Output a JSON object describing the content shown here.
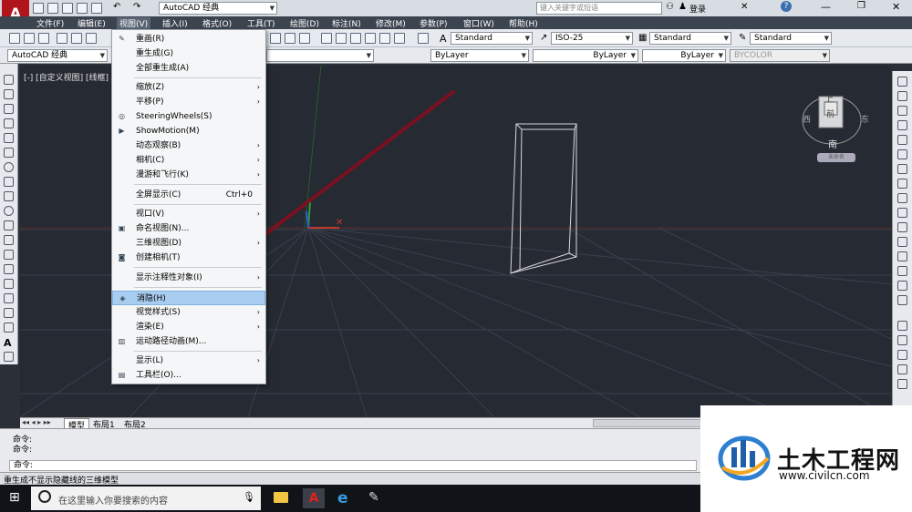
{
  "titlebar": {
    "workspace": "AutoCAD 经典",
    "search_placeholder": "键入关键字或短语",
    "login": "登录"
  },
  "menubar": [
    "文件(F)",
    "编辑(E)",
    "视图(V)",
    "插入(I)",
    "格式(O)",
    "工具(T)",
    "绘图(D)",
    "标注(N)",
    "修改(M)",
    "参数(P)",
    "窗口(W)",
    "帮助(H)"
  ],
  "toolbar": {
    "textstyle": "Standard",
    "dimstyle": "ISO-25",
    "tablestyle": "Standard",
    "mleaderstyle": "Standard",
    "workspace2": "AutoCAD 经典",
    "color": "ByLayer",
    "linetype": "ByLayer",
    "lineweight": "ByLayer",
    "plotstyle": "BYCOLOR"
  },
  "viewport": {
    "label": "[-] [自定义视图] [线框]"
  },
  "viewcube": {
    "top": "上",
    "front": "南",
    "west": "西",
    "east": "东",
    "face": "前",
    "wcs": "未命名"
  },
  "menu": {
    "items": [
      {
        "label": "重画(R)",
        "icon": "redraw-icon"
      },
      {
        "label": "重生成(G)"
      },
      {
        "label": "全部重生成(A)"
      },
      {
        "label": "缩放(Z)",
        "submenu": true
      },
      {
        "label": "平移(P)",
        "submenu": true
      },
      {
        "label": "SteeringWheels(S)",
        "icon": "steeringwheel-icon"
      },
      {
        "label": "ShowMotion(M)",
        "icon": "showmotion-icon"
      },
      {
        "label": "动态观察(B)",
        "submenu": true
      },
      {
        "label": "相机(C)",
        "submenu": true
      },
      {
        "label": "漫游和飞行(K)",
        "submenu": true
      },
      {
        "label": "全屏显示(C)",
        "shortcut": "Ctrl+0"
      },
      {
        "label": "视口(V)",
        "submenu": true
      },
      {
        "label": "命名视图(N)...",
        "icon": "namedview-icon"
      },
      {
        "label": "三维视图(D)",
        "submenu": true
      },
      {
        "label": "创建相机(T)",
        "icon": "camera-icon"
      },
      {
        "label": "显示注释性对象(I)",
        "submenu": true
      },
      {
        "label": "消隐(H)",
        "icon": "hide-icon",
        "highlighted": true
      },
      {
        "label": "视觉样式(S)",
        "submenu": true
      },
      {
        "label": "渲染(E)",
        "submenu": true
      },
      {
        "label": "运动路径动画(M)...",
        "icon": "motionpath-icon"
      },
      {
        "label": "显示(L)",
        "submenu": true
      },
      {
        "label": "工具栏(O)...",
        "icon": "toolbar-icon"
      }
    ]
  },
  "layout_tabs": [
    "模型",
    "布局1",
    "布局2"
  ],
  "command": {
    "line1": "命令:",
    "line2": "命令:",
    "prompt": "命令:"
  },
  "status_text": "重生成不显示隐藏线的三维模型",
  "taskbar": {
    "search_placeholder": "在这里输入你要搜索的内容"
  },
  "watermark": {
    "cn": "土木工程网",
    "url": "www.civilcn.com"
  },
  "colors": {
    "viewport_bg": "#262a33",
    "menu_highlight": "#a8cdf0",
    "arrow": "#7a1020",
    "x_axis": "#c0392b",
    "y_axis": "#2e9a3a",
    "z_axis": "#2e5bd6"
  }
}
